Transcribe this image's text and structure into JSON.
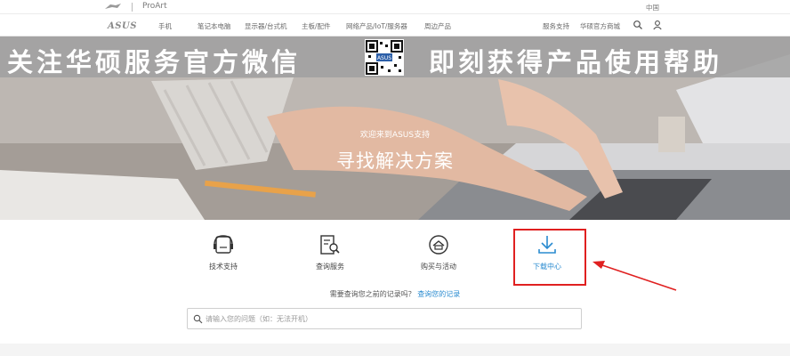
{
  "brandbar": {
    "proart": "ProArt",
    "region": "中国"
  },
  "nav": {
    "logo": "ASUS",
    "items": [
      {
        "label": "手机"
      },
      {
        "label": "笔记本电脑"
      },
      {
        "label": "显示器/台式机"
      },
      {
        "label": "主板/配件"
      },
      {
        "label": "网络产品/IoT/服务器"
      },
      {
        "label": "周边产品"
      }
    ],
    "right": [
      {
        "label": "服务支持"
      },
      {
        "label": "华硕官方商城"
      }
    ]
  },
  "hero": {
    "banner_left": "关注华硕服务官方微信",
    "banner_right": "即刻获得产品使用帮助",
    "qr_label": "ASUS",
    "subtitle": "欢迎来到ASUS支持",
    "title": "寻找解决方案"
  },
  "tiles": [
    {
      "label": "技术支持",
      "icon": "tech-support-icon"
    },
    {
      "label": "查询服务",
      "icon": "service-query-icon"
    },
    {
      "label": "购买与活动",
      "icon": "purchase-icon"
    },
    {
      "label": "下载中心",
      "icon": "download-icon"
    }
  ],
  "records": {
    "prompt": "需要查询您之前的记录吗？",
    "link": "查询您的记录"
  },
  "search": {
    "placeholder": "请输入您的问题（如：无法开机）"
  },
  "colors": {
    "accent": "#2a8bd0",
    "highlight": "#e02020",
    "banner": "#a0a0a0"
  }
}
